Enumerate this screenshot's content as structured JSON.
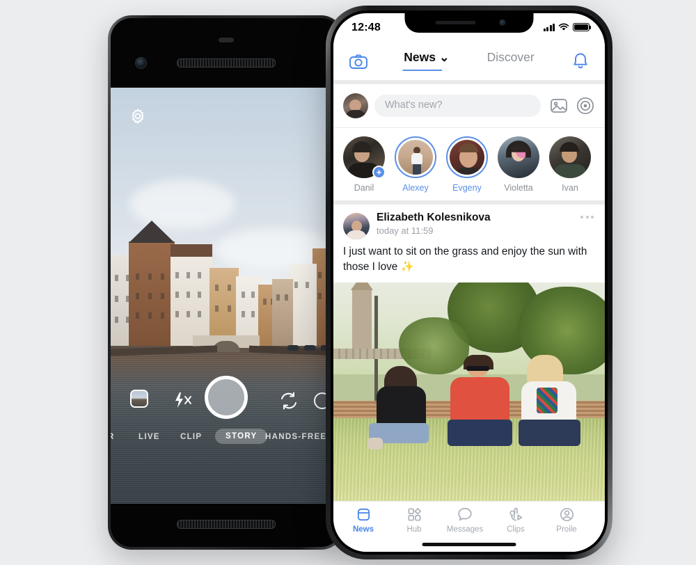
{
  "background_color": "#ECEDEF",
  "accent_color": "#4A86E8",
  "left_phone": {
    "device": "android-phone",
    "camera_app": {
      "settings_icon": "gear-icon",
      "thumbnail_icon": "gallery-thumbnail",
      "flash_icon": "flash-off-icon",
      "shutter_icon": "shutter-button",
      "flip_icon": "flip-camera-icon",
      "extra_icon": "effects-icon",
      "modes": [
        {
          "label": "R",
          "selected": false,
          "clipped": true
        },
        {
          "label": "LIVE",
          "selected": false
        },
        {
          "label": "CLIP",
          "selected": false
        },
        {
          "label": "STORY",
          "selected": true
        },
        {
          "label": "HANDS-FREE",
          "selected": false
        }
      ],
      "viewfinder_scene": "city canal with brick houses and bridge"
    }
  },
  "right_phone": {
    "device": "iphone-x",
    "status_bar": {
      "time": "12:48",
      "signal_icon": "cellular-bars-icon",
      "wifi_icon": "wifi-icon",
      "battery_icon": "battery-full-icon"
    },
    "nav_bar": {
      "camera_icon": "camera-icon",
      "bell_icon": "bell-icon",
      "tabs": [
        {
          "label": "News",
          "active": true,
          "chevron": "⌄"
        },
        {
          "label": "Discover",
          "active": false
        }
      ]
    },
    "composer": {
      "avatar": "user-avatar",
      "placeholder": "What's new?",
      "photo_icon": "image-icon",
      "target_icon": "live-camera-icon"
    },
    "stories": [
      {
        "name": "Danil",
        "ring": false,
        "has_add": true
      },
      {
        "name": "Alexey",
        "ring": true,
        "has_add": false
      },
      {
        "name": "Evgeny",
        "ring": true,
        "has_add": false
      },
      {
        "name": "Violetta",
        "ring": false,
        "has_add": false
      },
      {
        "name": "Ivan",
        "ring": false,
        "has_add": false
      }
    ],
    "post": {
      "author": "Elizabeth Kolesnikova",
      "timestamp": "today at 11:59",
      "menu_icon": "more-options-icon",
      "text": "I just want to sit on the grass and enjoy the sun with those I love ✨",
      "photo_alt": "three friends sitting on grass in a park"
    },
    "tab_bar": [
      {
        "label": "News",
        "icon": "news-icon",
        "active": true
      },
      {
        "label": "Hub",
        "icon": "hub-grid-icon",
        "active": false
      },
      {
        "label": "Messages",
        "icon": "message-bubble-icon",
        "active": false
      },
      {
        "label": "Clips",
        "icon": "clips-play-icon",
        "active": false
      },
      {
        "label": "Proile",
        "icon": "profile-person-icon",
        "active": false
      }
    ]
  }
}
